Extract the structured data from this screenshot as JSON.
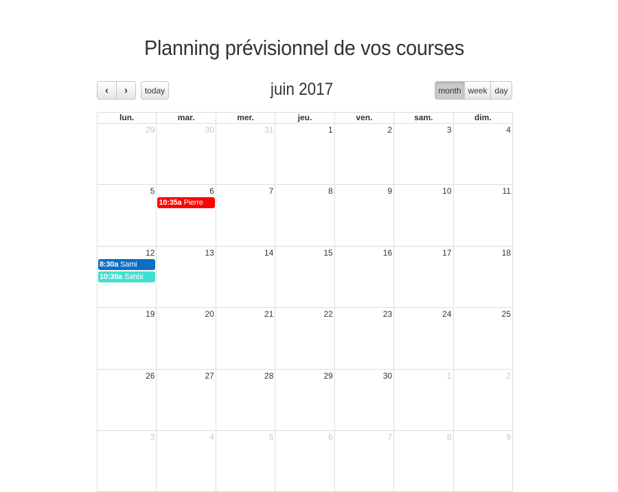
{
  "page_title": "Planning prévisionnel de vos courses",
  "toolbar": {
    "prev_icon": "chevron-left-icon",
    "next_icon": "chevron-right-icon",
    "prev_glyph": "‹",
    "next_glyph": "›",
    "today_label": "today",
    "title": "juin 2017",
    "views": [
      {
        "label": "month",
        "active": true
      },
      {
        "label": "week",
        "active": false
      },
      {
        "label": "day",
        "active": false
      }
    ]
  },
  "day_headers": [
    "lun.",
    "mar.",
    "mer.",
    "jeu.",
    "ven.",
    "sam.",
    "dim."
  ],
  "weeks": [
    [
      {
        "d": "29",
        "other": true
      },
      {
        "d": "30",
        "other": true
      },
      {
        "d": "31",
        "other": true
      },
      {
        "d": "1"
      },
      {
        "d": "2"
      },
      {
        "d": "3"
      },
      {
        "d": "4"
      }
    ],
    [
      {
        "d": "5"
      },
      {
        "d": "6",
        "events": [
          {
            "time": "10:35a",
            "title": "Pierre",
            "color": "#ff0000"
          }
        ]
      },
      {
        "d": "7"
      },
      {
        "d": "8"
      },
      {
        "d": "9"
      },
      {
        "d": "10"
      },
      {
        "d": "11"
      }
    ],
    [
      {
        "d": "12",
        "events": [
          {
            "time": "8:30a",
            "title": "Sami",
            "color": "#0d6fc4"
          },
          {
            "time": "10:30a",
            "title": "Sahbi",
            "color": "#40e0d0"
          }
        ]
      },
      {
        "d": "13"
      },
      {
        "d": "14"
      },
      {
        "d": "15"
      },
      {
        "d": "16"
      },
      {
        "d": "17"
      },
      {
        "d": "18"
      }
    ],
    [
      {
        "d": "19"
      },
      {
        "d": "20"
      },
      {
        "d": "21"
      },
      {
        "d": "22"
      },
      {
        "d": "23"
      },
      {
        "d": "24"
      },
      {
        "d": "25"
      }
    ],
    [
      {
        "d": "26"
      },
      {
        "d": "27"
      },
      {
        "d": "28"
      },
      {
        "d": "29"
      },
      {
        "d": "30"
      },
      {
        "d": "1",
        "other": true
      },
      {
        "d": "2",
        "other": true
      }
    ],
    [
      {
        "d": "3",
        "other": true
      },
      {
        "d": "4",
        "other": true
      },
      {
        "d": "5",
        "other": true
      },
      {
        "d": "6",
        "other": true
      },
      {
        "d": "7",
        "other": true
      },
      {
        "d": "8",
        "other": true
      },
      {
        "d": "9",
        "other": true
      }
    ]
  ]
}
